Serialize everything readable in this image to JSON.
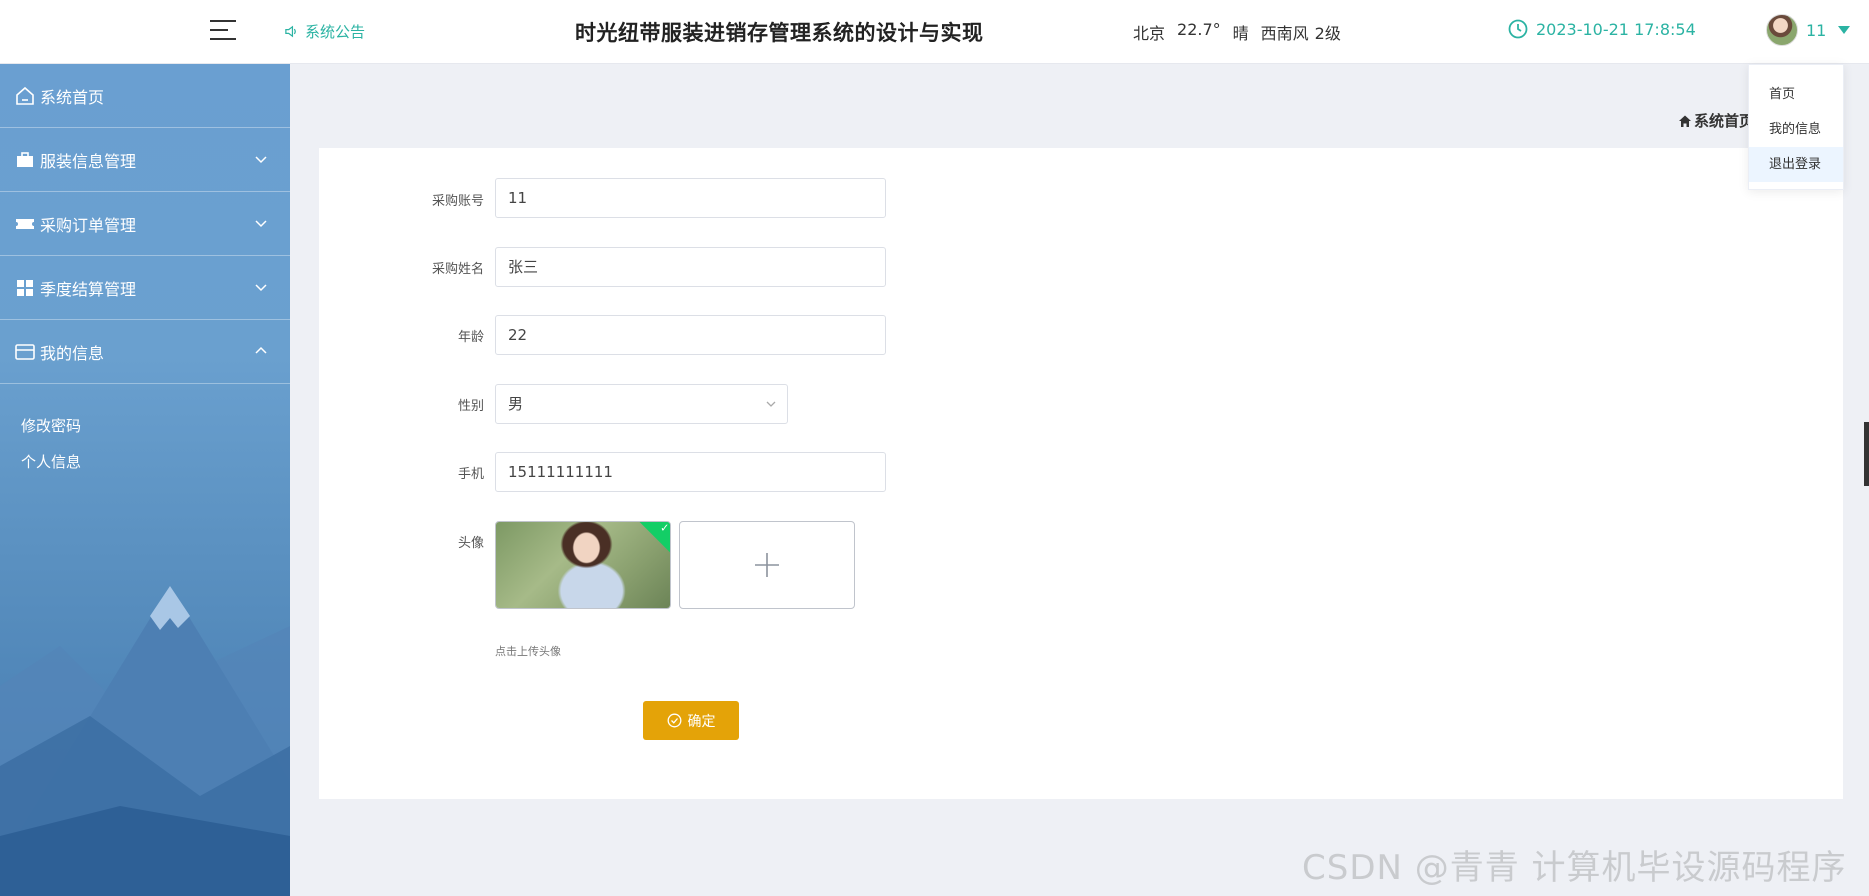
{
  "header": {
    "notice_label": "系统公告",
    "title": "时光纽带服装进销存管理系统的设计与实现",
    "weather": {
      "city": "北京",
      "temp": "22.7°",
      "condition": "晴",
      "wind": "西南风",
      "level": "2级"
    },
    "datetime": "2023-10-21 17:8:54",
    "user_name": "11"
  },
  "user_menu": {
    "items": [
      "首页",
      "我的信息",
      "退出登录"
    ],
    "hovered_index": 2
  },
  "sidebar": {
    "items": [
      {
        "label": "系统首页",
        "icon": "home-icon"
      },
      {
        "label": "服装信息管理",
        "icon": "briefcase-icon"
      },
      {
        "label": "采购订单管理",
        "icon": "ticket-icon"
      },
      {
        "label": "季度结算管理",
        "icon": "grid-icon"
      },
      {
        "label": "我的信息",
        "icon": "id-card-icon"
      }
    ],
    "submenu": [
      "修改密码",
      "个人信息"
    ]
  },
  "breadcrumb": {
    "label": "系统首页"
  },
  "form": {
    "account": {
      "label": "采购账号",
      "value": "11"
    },
    "name": {
      "label": "采购姓名",
      "value": "张三"
    },
    "age": {
      "label": "年龄",
      "value": "22"
    },
    "gender": {
      "label": "性别",
      "value": "男"
    },
    "phone": {
      "label": "手机",
      "value": "15111111111"
    },
    "avatar": {
      "label": "头像",
      "tip": "点击上传头像"
    },
    "submit_label": "确定"
  },
  "watermark": "CSDN @青青  计算机毕设源码程序",
  "colors": {
    "accent": "#2bb3a3",
    "button": "#e4a308",
    "sidebar": "#6a9fd1"
  }
}
